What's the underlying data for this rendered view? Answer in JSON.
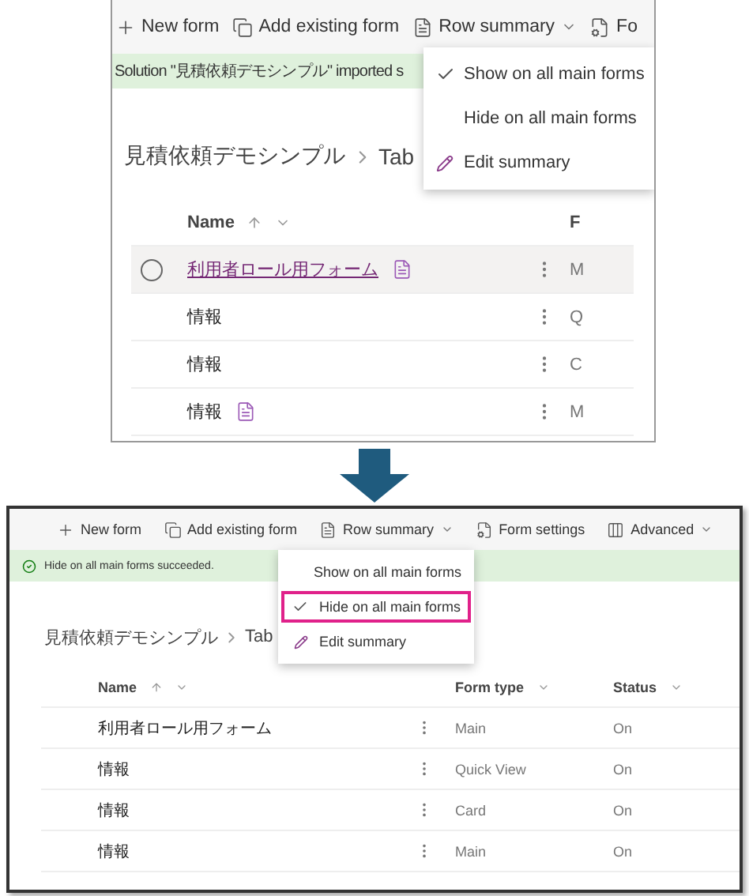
{
  "panels": [
    {
      "toolbar": [
        {
          "kind": "new",
          "label": "New form"
        },
        {
          "kind": "existing",
          "label": "Add existing form"
        },
        {
          "kind": "summary",
          "label": "Row summary",
          "dropdown": true
        },
        {
          "kind": "settings",
          "label": "Fo"
        }
      ],
      "banner": {
        "kind": "plain",
        "text": "Solution \"見積依頼デモシンプル\" imported s"
      },
      "menu": [
        {
          "kind": "option",
          "label": "Show on all main forms",
          "checked": true,
          "highlighted": false
        },
        {
          "kind": "option",
          "label": "Hide on all main forms",
          "checked": false,
          "highlighted": false
        },
        {
          "kind": "edit",
          "label": "Edit summary",
          "highlighted": false
        }
      ],
      "breadcrumb": [
        "見積依頼デモシンプル",
        "Tab"
      ],
      "columns": [
        {
          "label": "Name",
          "sorted": true
        },
        {
          "label": "F",
          "sorted": false
        }
      ],
      "rows": [
        {
          "hovered": true,
          "summary": true,
          "cells": [
            "利用者ロール用フォーム",
            "M"
          ]
        },
        {
          "hovered": false,
          "summary": false,
          "cells": [
            "情報",
            "Q"
          ]
        },
        {
          "hovered": false,
          "summary": false,
          "cells": [
            "情報",
            "C"
          ]
        },
        {
          "hovered": false,
          "summary": true,
          "cells": [
            "情報",
            "M"
          ]
        }
      ]
    },
    {
      "toolbar": [
        {
          "kind": "new",
          "label": "New form"
        },
        {
          "kind": "existing",
          "label": "Add existing form"
        },
        {
          "kind": "summary",
          "label": "Row summary",
          "dropdown": true
        },
        {
          "kind": "settings",
          "label": "Form settings"
        },
        {
          "kind": "advanced",
          "label": "Advanced",
          "dropdown": true
        }
      ],
      "banner": {
        "kind": "success",
        "text": "Hide on all main forms succeeded."
      },
      "menu": [
        {
          "kind": "option",
          "label": "Show on all main forms",
          "checked": false,
          "highlighted": false
        },
        {
          "kind": "option",
          "label": "Hide on all main forms",
          "checked": true,
          "highlighted": true
        },
        {
          "kind": "edit",
          "label": "Edit summary",
          "highlighted": false
        }
      ],
      "breadcrumb": [
        "見積依頼デモシンプル",
        "Tab"
      ],
      "columns": [
        {
          "label": "Name",
          "sorted": true
        },
        {
          "label": "Form type",
          "sorted": false
        },
        {
          "label": "Status",
          "sorted": false
        }
      ],
      "rows": [
        {
          "hovered": false,
          "summary": false,
          "cells": [
            "利用者ロール用フォーム",
            "Main",
            "On"
          ]
        },
        {
          "hovered": false,
          "summary": false,
          "cells": [
            "情報",
            "Quick View",
            "On"
          ]
        },
        {
          "hovered": false,
          "summary": false,
          "cells": [
            "情報",
            "Card",
            "On"
          ]
        },
        {
          "hovered": false,
          "summary": false,
          "cells": [
            "情報",
            "Main",
            "On"
          ]
        }
      ]
    }
  ]
}
